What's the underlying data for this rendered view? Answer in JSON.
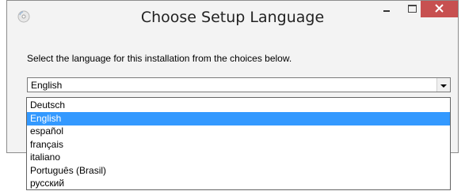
{
  "window": {
    "title": "Choose Setup Language",
    "minimize_glyph": "−",
    "maximize_glyph": "□",
    "close_glyph": "✕"
  },
  "content": {
    "instruction": "Select the language for this installation from the choices below."
  },
  "language_select": {
    "selected_value": "English",
    "options": [
      {
        "label": "Deutsch",
        "selected": false
      },
      {
        "label": "English",
        "selected": true
      },
      {
        "label": "español",
        "selected": false
      },
      {
        "label": "français",
        "selected": false
      },
      {
        "label": "italiano",
        "selected": false
      },
      {
        "label": "Português (Brasil)",
        "selected": false
      },
      {
        "label": "русский",
        "selected": false
      }
    ]
  },
  "colors": {
    "close_button": "#c75050",
    "selection_highlight": "#3399ff"
  }
}
